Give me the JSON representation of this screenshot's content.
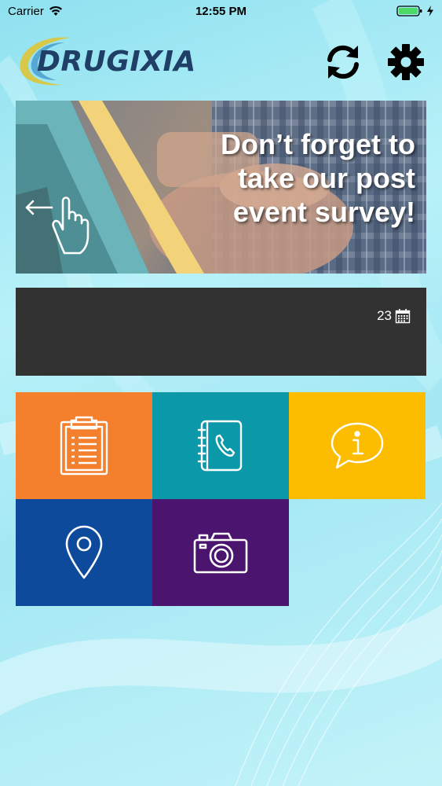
{
  "status_bar": {
    "carrier": "Carrier",
    "time": "12:55 PM"
  },
  "header": {
    "logo_text": "DRUGIXIA",
    "refresh_icon": "refresh-icon",
    "settings_icon": "gear-icon"
  },
  "banner": {
    "message": "Don’t forget to take our post event survey!",
    "swipe_icon": "swipe-left-hand-icon"
  },
  "event_bar": {
    "date_count": "23",
    "date_icon": "calendar-icon"
  },
  "tiles": [
    {
      "icon": "clipboard-icon",
      "color": "#f47f2c"
    },
    {
      "icon": "phone-book-icon",
      "color": "#0b98a8"
    },
    {
      "icon": "info-bubble-icon",
      "color": "#fcbc00"
    },
    {
      "icon": "map-pin-icon",
      "color": "#0e4a9c"
    },
    {
      "icon": "camera-icon",
      "color": "#4a146f"
    }
  ],
  "colors": {
    "logo_navy": "#1f3f66",
    "logo_swoosh": "#d8c84a",
    "event_bar": "#323232"
  }
}
